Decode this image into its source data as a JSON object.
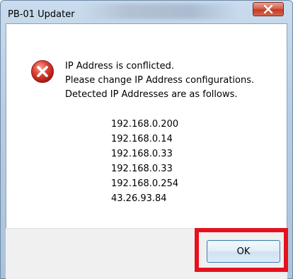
{
  "window": {
    "title": "PB-01 Updater"
  },
  "message": {
    "lines": [
      "IP Address is conflicted.",
      "Please change IP Address configurations.",
      "Detected IP Addresses are as follows."
    ],
    "ip_addresses": [
      "192.168.0.200",
      "192.168.0.14",
      "192.168.0.33",
      "192.168.0.33",
      "192.168.0.254",
      "43.26.93.84"
    ]
  },
  "buttons": {
    "ok_label": "OK"
  },
  "icons": {
    "error": "error-icon",
    "close": "close-icon"
  },
  "colors": {
    "error_red": "#d9312b",
    "close_button": "#c23b24",
    "highlight": "#e5121d"
  }
}
